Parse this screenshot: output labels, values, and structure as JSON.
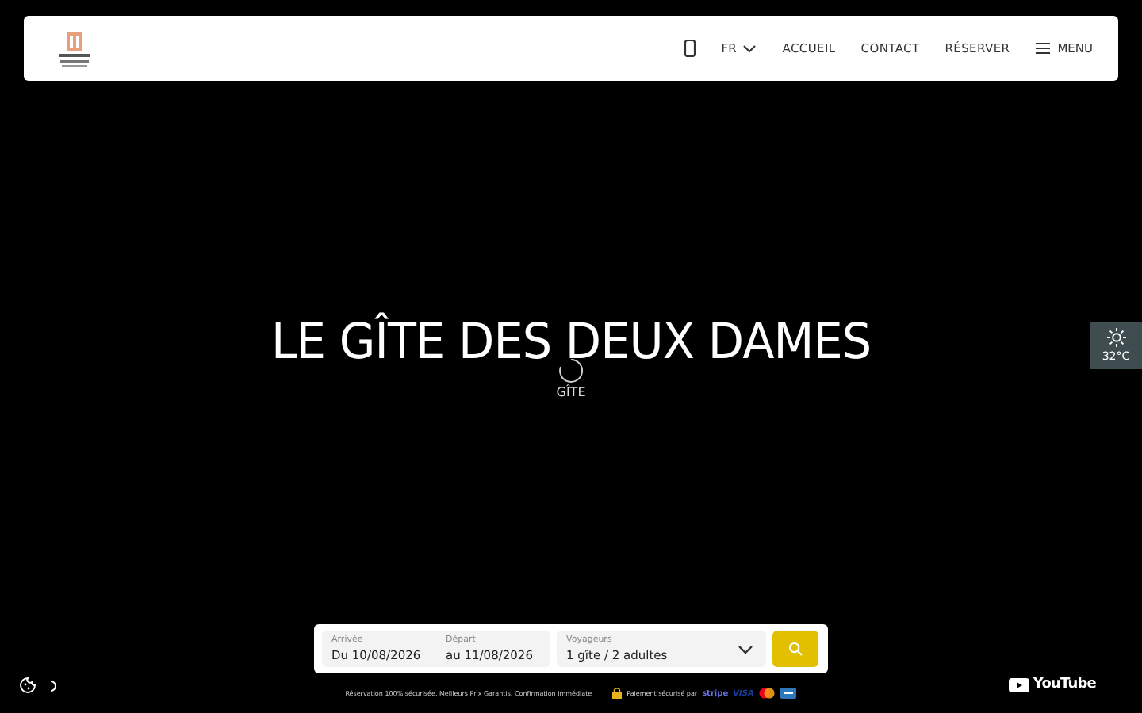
{
  "header": {
    "language": "FR",
    "nav": [
      {
        "label": "ACCUEIL"
      },
      {
        "label": "CONTACT"
      },
      {
        "label": "RÉSERVER"
      }
    ],
    "menu": "MENU"
  },
  "hero": {
    "title": "LE GÎTE DES DEUX DAMES",
    "subtitle": "GÎTE"
  },
  "weather": {
    "temperature": "32°C"
  },
  "booking": {
    "fields": [
      {
        "label": "Arrivée",
        "value": "Du 10/08/2026"
      },
      {
        "label": "Départ",
        "value": "au 11/08/2026"
      }
    ],
    "guests": {
      "label": "Voyageurs",
      "value": "1 gîte / 2 adultes"
    }
  },
  "footer": {
    "guarantees": "Réservation 100% sécurisée, Meilleurs Prix Garantis, Confirmation immédiate",
    "payment": "Paiement sécurisé par",
    "payment_brands": [
      "stripe",
      "VISA"
    ],
    "video_link": "YouTube"
  }
}
